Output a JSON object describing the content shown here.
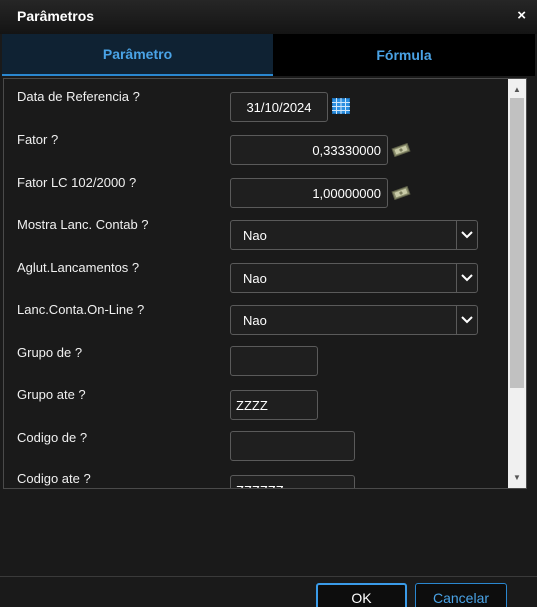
{
  "window": {
    "title": "Parâmetros",
    "close_label": "×"
  },
  "tabs": [
    {
      "label": "Parâmetro",
      "active": true
    },
    {
      "label": "Fórmula",
      "active": false
    }
  ],
  "fields": {
    "data_referencia": {
      "label": "Data de Referencia ?",
      "value": "31/10/2024"
    },
    "fator": {
      "label": "Fator ?",
      "value": "0,33330000"
    },
    "fator_lc": {
      "label": "Fator LC 102/2000 ?",
      "value": "1,00000000"
    },
    "mostra_lanc": {
      "label": "Mostra Lanc. Contab ?",
      "value": "Nao"
    },
    "aglut_lanc": {
      "label": "Aglut.Lancamentos ?",
      "value": "Nao"
    },
    "lanc_conta": {
      "label": "Lanc.Conta.On-Line ?",
      "value": "Nao"
    },
    "grupo_de": {
      "label": "Grupo de ?",
      "value": ""
    },
    "grupo_ate": {
      "label": "Grupo ate ?",
      "value": "ZZZZ"
    },
    "codigo_de": {
      "label": "Codigo de ?",
      "value": ""
    },
    "codigo_ate": {
      "label": "Codigo ate ?",
      "value": "ZZZZZZ"
    }
  },
  "buttons": {
    "ok": "OK",
    "cancel": "Cancelar"
  },
  "colors": {
    "accent": "#2a87d0",
    "tab_text": "#4aa3e6",
    "background": "#1a1a1a"
  }
}
